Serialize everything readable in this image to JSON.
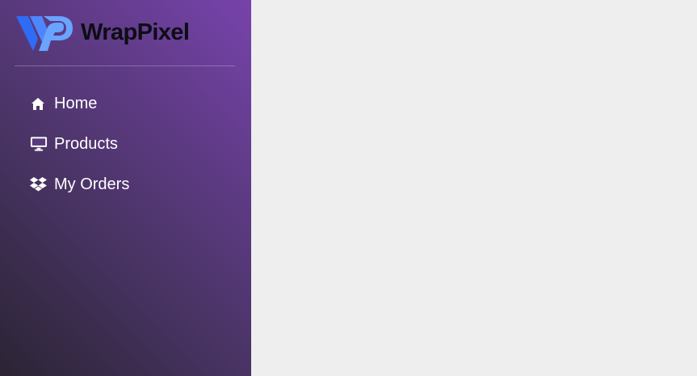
{
  "brand": {
    "name": "WrapPixel",
    "logo_icon": "wrappixel-logo-icon"
  },
  "colors": {
    "logo_blue_dark": "#2f6cf6",
    "logo_blue_light": "#69a4ff",
    "sidebar_gradient_start": "#2b2434",
    "sidebar_gradient_end": "#7743ab",
    "main_background": "#eeeeee",
    "nav_text": "#ffffff"
  },
  "sidebar": {
    "items": [
      {
        "label": "Home",
        "icon": "home-icon"
      },
      {
        "label": "Products",
        "icon": "desktop-icon"
      },
      {
        "label": "My Orders",
        "icon": "dropbox-icon"
      }
    ]
  }
}
